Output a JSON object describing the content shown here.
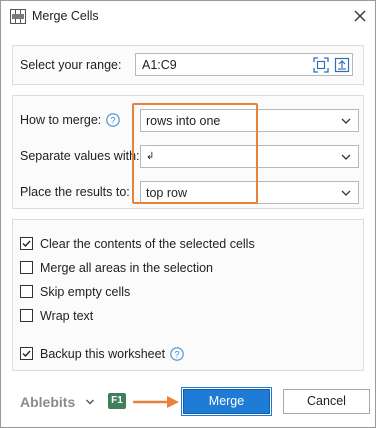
{
  "window": {
    "title": "Merge Cells",
    "close_icon": "close-icon",
    "app_icon": "merge-cells-icon"
  },
  "range": {
    "label": "Select your range:",
    "value": "A1:C9",
    "icons": [
      "select-range-icon",
      "collapse-dialog-icon"
    ]
  },
  "options": {
    "how_to_merge": {
      "label": "How to merge:",
      "value": "rows into one",
      "help_icon": "help-icon"
    },
    "separate_values": {
      "label": "Separate values with:",
      "value": "↲"
    },
    "place_results": {
      "label": "Place the results to:",
      "value": "top row"
    }
  },
  "checkboxes": [
    {
      "label": "Clear the contents of the selected cells",
      "checked": true
    },
    {
      "label": "Merge all areas in the selection",
      "checked": false
    },
    {
      "label": "Skip empty cells",
      "checked": false
    },
    {
      "label": "Wrap text",
      "checked": false
    }
  ],
  "backup": {
    "label": "Backup this worksheet",
    "checked": true,
    "help_icon": "help-icon"
  },
  "footer": {
    "brand": "Ablebits",
    "f1": "F1",
    "merge_label": "Merge",
    "cancel_label": "Cancel"
  },
  "colors": {
    "accent": "#1e7bd6",
    "highlight": "#e8823a",
    "help": "#3b8fd9",
    "brand": "#8a8a8a",
    "f1_badge": "#3f7f5a"
  }
}
